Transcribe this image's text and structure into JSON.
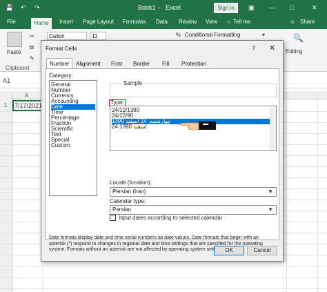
{
  "titlebar": {
    "book": "Book1",
    "separator": "-",
    "app": "Excel",
    "signin": "Sign in"
  },
  "tabs": [
    "File",
    "Home",
    "Insert",
    "Page Layout",
    "Formulas",
    "Data",
    "Review",
    "View",
    "Tell me",
    "Share"
  ],
  "ribbon": {
    "paste": "Paste",
    "clipboard": "Clipboard",
    "font_name": "Calibri",
    "font_size": "11",
    "cond_format": "Conditional Formatting",
    "editing": "Editing"
  },
  "formula": {
    "name_box": "A1"
  },
  "grid": {
    "col_a": "A",
    "row_1": "1",
    "a1_value": "7/17/2021"
  },
  "dialog": {
    "title": "Format Cells",
    "help": "?",
    "tabs": [
      "Number",
      "Alignment",
      "Font",
      "Border",
      "Fill",
      "Protection"
    ],
    "category_label": "Category:",
    "categories": [
      "General",
      "Number",
      "Currency",
      "Accounting",
      "Date",
      "Time",
      "Percentage",
      "Fraction",
      "Scientific",
      "Text",
      "Special",
      "Custom"
    ],
    "selected_category": "Date",
    "sample_label": "Sample",
    "type_label": "Type:",
    "types": [
      "24/12/1390",
      "24/12/90",
      "چهارشنبه, 24 اسفند 1390",
      "24 اسفند 1390"
    ],
    "selected_type": "چهارشنبه, 24 اسفند 1390",
    "locale_label": "Locale (location):",
    "locale_value": "Persian (Iran)",
    "calendar_label": "Calendar type:",
    "calendar_value": "Persian",
    "checkbox_label": "Input dates according to selected calendar",
    "description": "Date formats display date and time serial numbers as date values.  Date formats that begin with an asterisk (*) respond to changes in regional date and time settings that are specified for the operating system. Formats without an asterisk are not affected by operating system settings.",
    "ok": "OK",
    "cancel": "Cancel"
  },
  "colors": {
    "excel_green": "#217346",
    "selection_blue": "#0078d7",
    "highlight_red": "#e81123"
  }
}
